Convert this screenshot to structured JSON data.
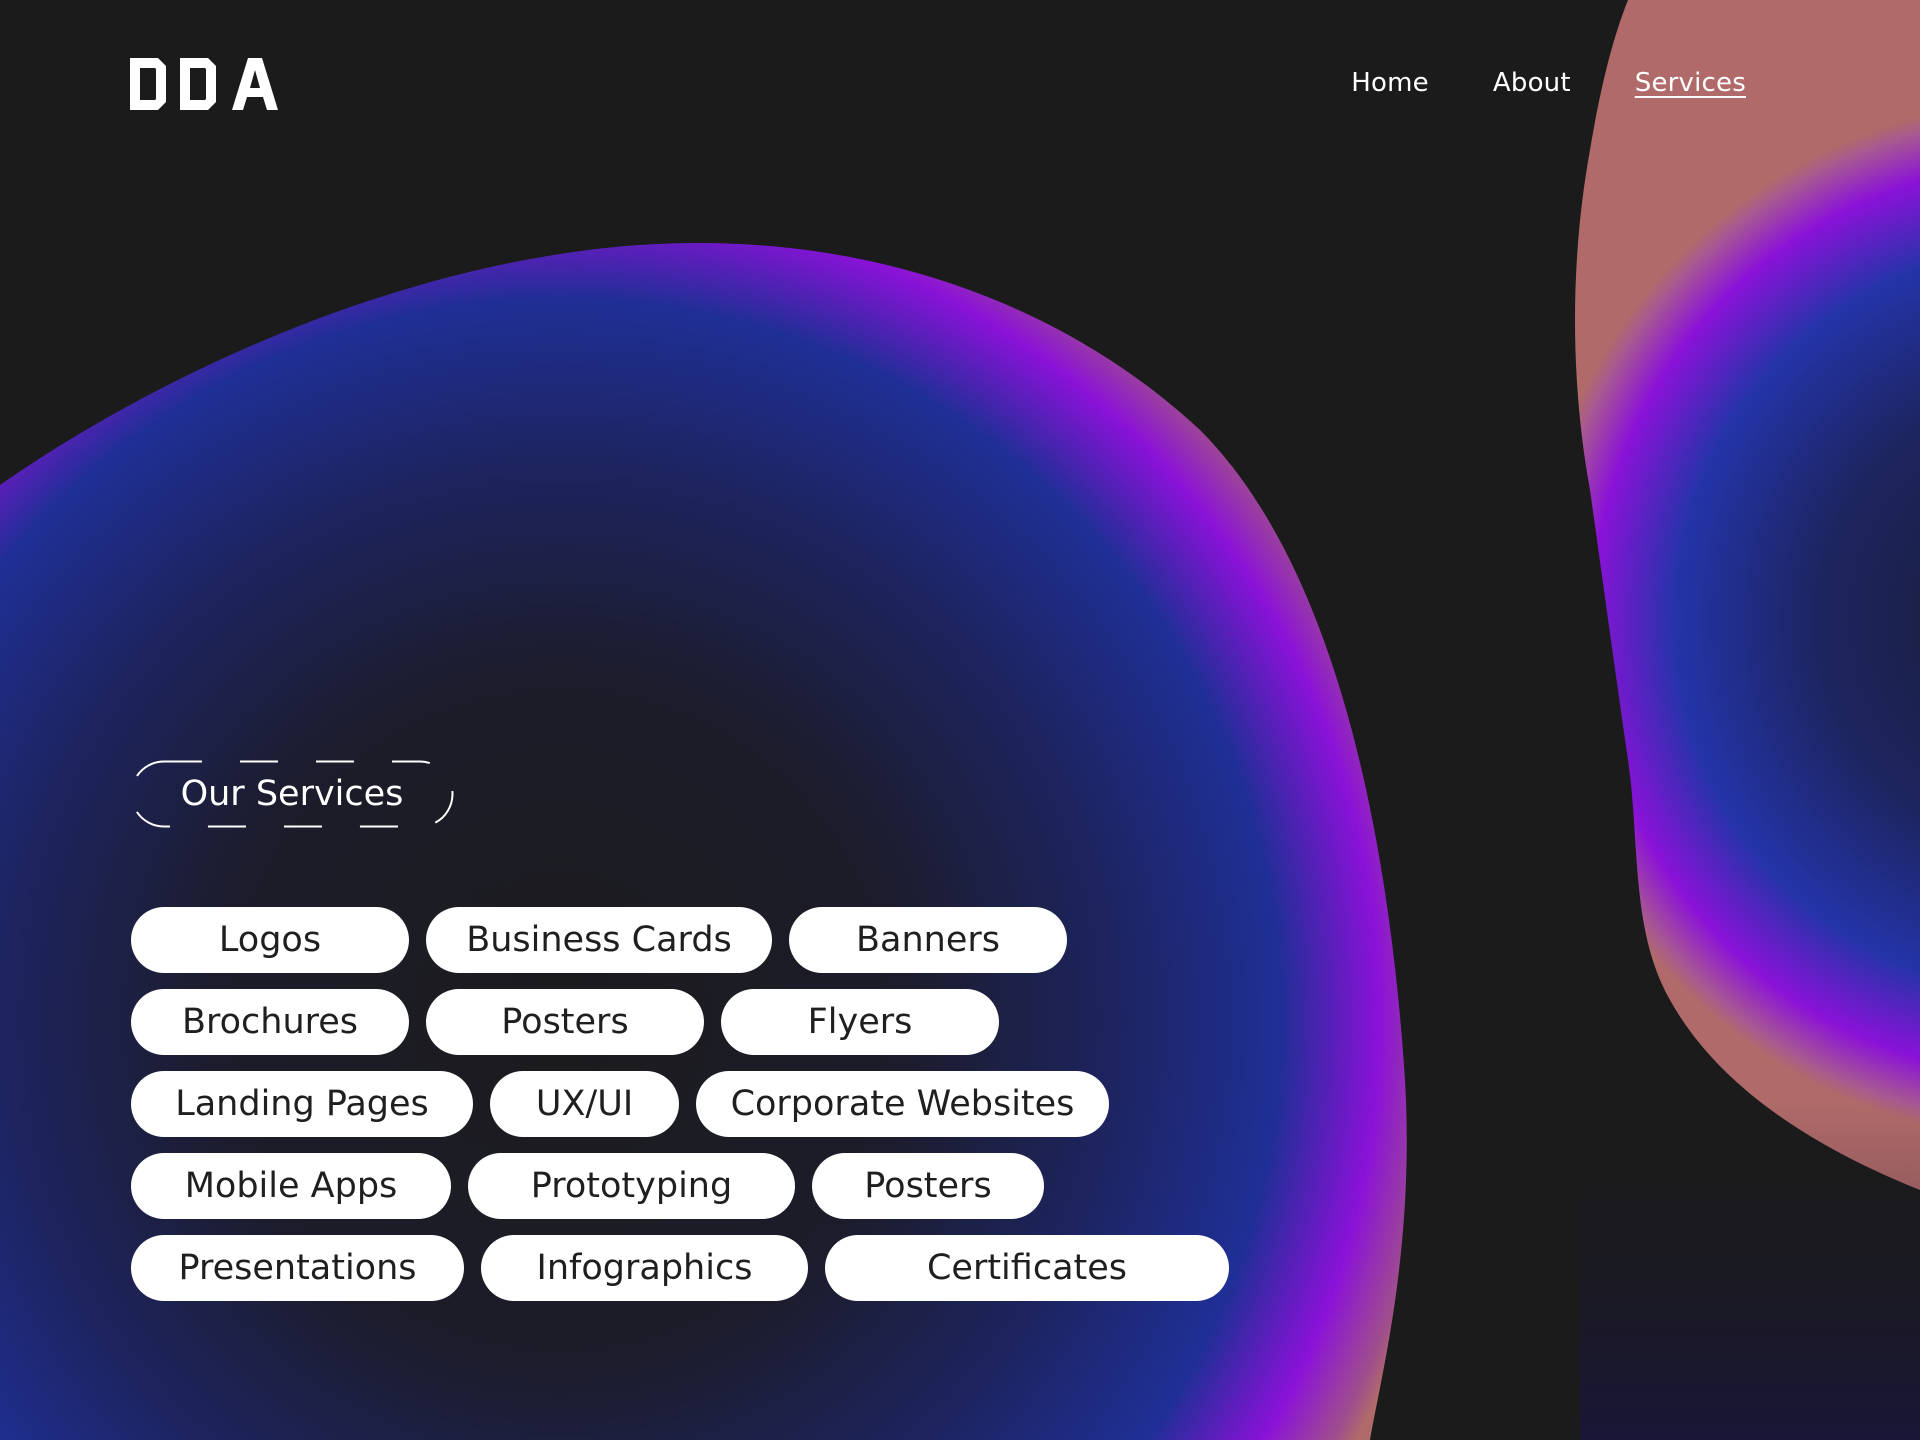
{
  "header": {
    "logo_text": "DDA",
    "nav": [
      {
        "label": "Home",
        "active": false
      },
      {
        "label": "About",
        "active": false
      },
      {
        "label": "Services",
        "active": true
      }
    ]
  },
  "services": {
    "heading": "Our Services",
    "rows": [
      [
        "Logos",
        "Business Cards",
        "Banners"
      ],
      [
        "Brochures",
        "Posters",
        "Flyers"
      ],
      [
        "Landing Pages",
        "UX/UI",
        "Corporate Websites"
      ],
      [
        "Mobile Apps",
        "Prototyping",
        "Posters"
      ],
      [
        "Presentations",
        "Infographics",
        "Certificates"
      ]
    ]
  },
  "colors": {
    "background": "#1b1b1b",
    "blob_blue": "#1e2a8a",
    "blob_violet": "#8a0fd8",
    "blob_rim": "#b06a6a",
    "tag_bg": "#ffffff",
    "tag_text": "#1f1f1f",
    "text": "#ffffff"
  }
}
